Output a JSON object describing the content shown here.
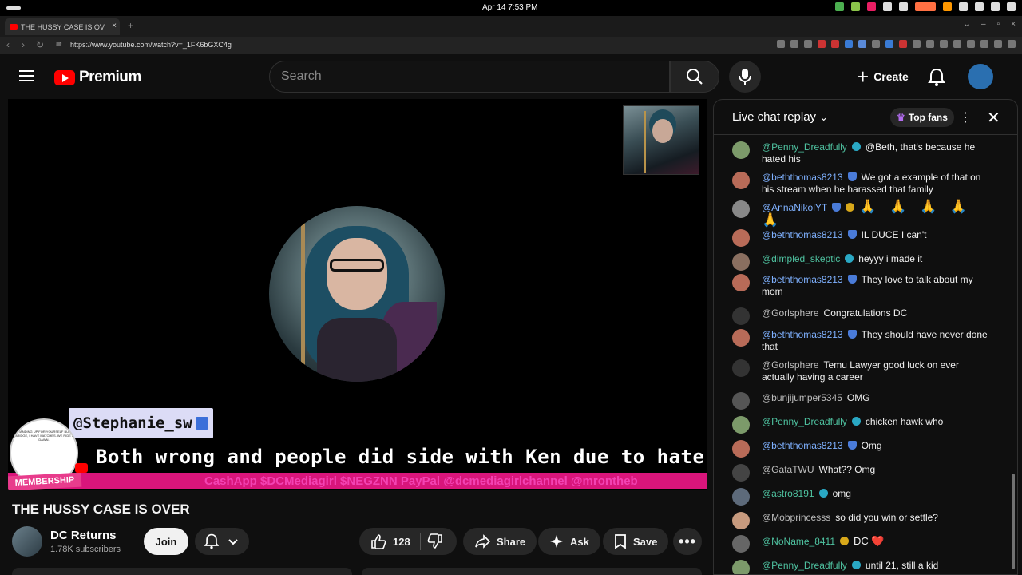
{
  "system": {
    "clock": "Apr 14    7:53 PM",
    "tray_colors": [
      "#4caf50",
      "#8bc34a",
      "#e91e63",
      "#ffffff",
      "#ffffff",
      "#ff7043",
      "#ff9800",
      "#ffffff",
      "#ffffff",
      "#ffffff",
      "#ffffff"
    ]
  },
  "browser": {
    "tab_title": "THE HUSSY CASE IS OV",
    "url": "https://www.youtube.com/watch?v=_1FK6bGXC4g"
  },
  "header": {
    "logo_text": "Premium",
    "search_placeholder": "Search",
    "create_label": "Create"
  },
  "overlay": {
    "username": "@Stephanie_sw",
    "message": "Both wrong and people did side with Ken due to hate for negz.",
    "ticker": "CashApp $DCMediagirl $NEGZNN PayPal @dcmediagirlchannel @mrontheb",
    "membership_label": "MEMBERSHIP",
    "membership_text": "IF STANDING UP FOR YOURSELF BURNS A BRIDGE, I HAVE MATCHES. WE RIDE AT DAWN."
  },
  "video": {
    "title": "THE HUSSY CASE IS OVER",
    "channel_name": "DC Returns",
    "subscribers": "1.78K subscribers",
    "join_label": "Join",
    "like_count": "128",
    "share_label": "Share",
    "ask_label": "Ask",
    "save_label": "Save"
  },
  "chat": {
    "title": "Live chat replay",
    "top_fans_label": "Top fans",
    "messages": [
      {
        "author": "@Penny_Dreadfully",
        "text": "@Beth, that's because he hated his"
      },
      {
        "author": "@beththomas8213",
        "text": "We got a example of that on his stream when he harassed that family"
      },
      {
        "author": "@AnnaNikolYT",
        "text": "🙏 🙏 🙏 🙏 🙏"
      },
      {
        "author": "@beththomas8213",
        "text": "IL DUCE I can't"
      },
      {
        "author": "@dimpled_skeptic",
        "text": "heyyy i made it"
      },
      {
        "author": "@beththomas8213",
        "text": "They love to talk about my mom"
      },
      {
        "author": "@Gorlsphere",
        "text": "Congratulations DC"
      },
      {
        "author": "@beththomas8213",
        "text": "They should have never done that"
      },
      {
        "author": "@Gorlsphere",
        "text": "Temu Lawyer good luck on ever actually having a career"
      },
      {
        "author": "@bunjijumper5345",
        "text": "OMG"
      },
      {
        "author": "@Penny_Dreadfully",
        "text": "chicken hawk who"
      },
      {
        "author": "@beththomas8213",
        "text": "Omg"
      },
      {
        "author": "@GataTWU",
        "text": "What?? Omg"
      },
      {
        "author": "@astro8191",
        "text": "omg"
      },
      {
        "author": "@Mobprincesss",
        "text": "so did you win or settle?"
      },
      {
        "author": "@NoName_8411",
        "text": "DC ❤️"
      },
      {
        "author": "@Penny_Dreadfully",
        "text": "until 21, still a kid"
      }
    ]
  }
}
